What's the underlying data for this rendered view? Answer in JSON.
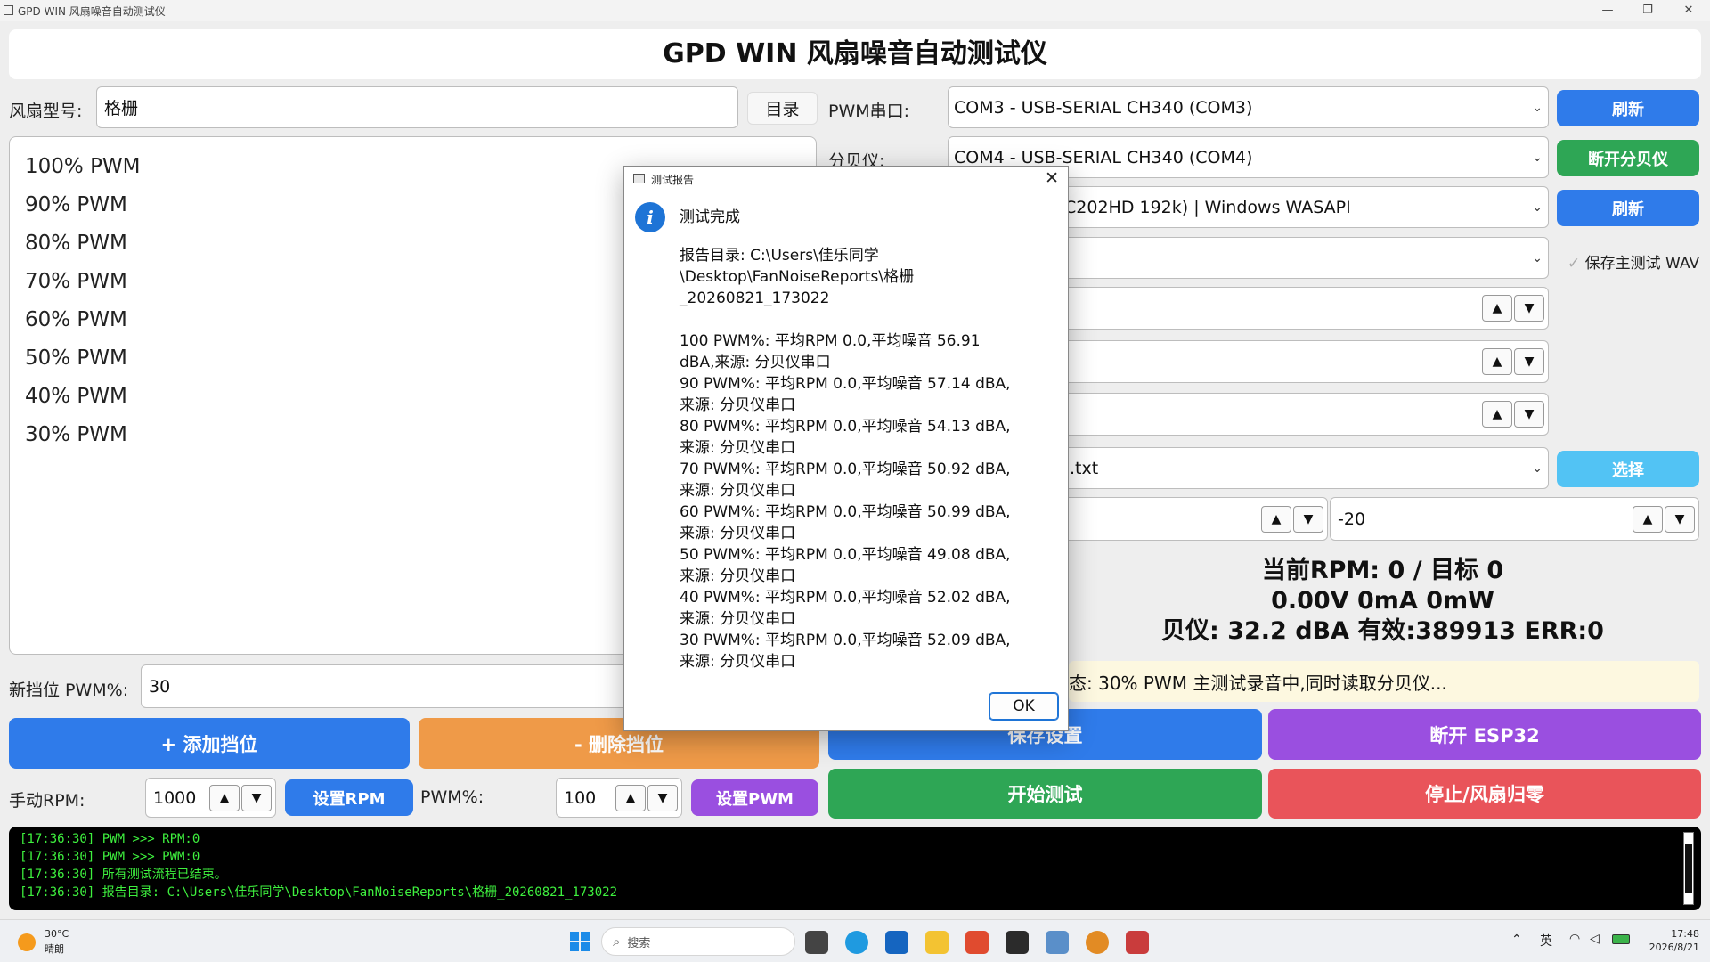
{
  "window": {
    "title": "GPD WIN 风扇噪音自动测试仪",
    "heading": "GPD WIN 风扇噪音自动测试仪"
  },
  "left": {
    "fan_model_label": "风扇型号:",
    "fan_model_value": "格栅",
    "dir_button": "目录",
    "gears": [
      "100% PWM",
      "90% PWM",
      "80% PWM",
      "70% PWM",
      "60% PWM",
      "50% PWM",
      "40% PWM",
      "30% PWM"
    ],
    "new_gear_label": "新挡位 PWM%:",
    "new_gear_value": "30",
    "add_gear_button": "+ 添加挡位",
    "delete_gear_button": "- 删除挡位",
    "manual_rpm_label": "手动RPM:",
    "manual_rpm_value": "1000",
    "set_rpm_button": "设置RPM",
    "pwm_label": "PWM%:",
    "pwm_value": "100",
    "set_pwm_button": "设置PWM"
  },
  "right": {
    "pwm_port_label": "PWM串口:",
    "pwm_port_value": "COM3 - USB-SERIAL CH340 (COM3)",
    "refresh_button": "刷新",
    "db_meter_label": "分贝仪:",
    "db_meter_value": "COM4 - USB-SERIAL CH340 (COM4)",
    "disconnect_db_button": "断开分贝仪",
    "audio_value": "C202HD 192k) | Windows WASAPI",
    "refresh_button_2": "刷新",
    "save_wav_label": "保存主测试 WAV",
    "file_value": ".txt",
    "choose_button": "选择",
    "offset_value": "-20",
    "current_rpm": "当前RPM: 0 / 目标 0",
    "power": "0.00V  0mA  0mW",
    "db_reading": "贝仪: 32.2 dBA  有效:389913  ERR:0",
    "status_text": "态: 30% PWM 主测试录音中,同时读取分贝仪...",
    "save_settings_button": "保存设置",
    "disconnect_esp_button": "断开 ESP32",
    "start_test_button": "开始测试",
    "stop_button": "停止/风扇归零"
  },
  "log": [
    "[17:36:30] PWM >>> RPM:0",
    "[17:36:30] PWM >>> PWM:0",
    "[17:36:30] 所有测试流程已结束。",
    "[17:36:30] 报告目录: C:\\Users\\佳乐同学\\Desktop\\FanNoiseReports\\格栅_20260821_173022"
  ],
  "dialog": {
    "title": "测试报告",
    "heading": "测试完成",
    "body": "报告目录: C:\\Users\\佳乐同学\n\\Desktop\\FanNoiseReports\\格栅\n_20260821_173022\n\n100 PWM%: 平均RPM 0.0,平均噪音 56.91\ndBA,来源: 分贝仪串口\n90 PWM%: 平均RPM 0.0,平均噪音 57.14 dBA,\n来源: 分贝仪串口\n80 PWM%: 平均RPM 0.0,平均噪音 54.13 dBA,\n来源: 分贝仪串口\n70 PWM%: 平均RPM 0.0,平均噪音 50.92 dBA,\n来源: 分贝仪串口\n60 PWM%: 平均RPM 0.0,平均噪音 50.99 dBA,\n来源: 分贝仪串口\n50 PWM%: 平均RPM 0.0,平均噪音 49.08 dBA,\n来源: 分贝仪串口\n40 PWM%: 平均RPM 0.0,平均噪音 52.02 dBA,\n来源: 分贝仪串口\n30 PWM%: 平均RPM 0.0,平均噪音 52.09 dBA,\n来源: 分贝仪串口",
    "ok_button": "OK"
  },
  "taskbar": {
    "weather_temp": "30°C",
    "weather_desc": "晴朗",
    "search_placeholder": "搜索",
    "ime": "英",
    "time": "17:48",
    "date": "2026/8/21"
  },
  "colors": {
    "blue": "#2f7bea",
    "green": "#2ea655",
    "cyan": "#52c3f4",
    "orange": "#ef9a48",
    "purple": "#9a4fe0",
    "red": "#e9545a",
    "log_text": "#3ef03e"
  }
}
